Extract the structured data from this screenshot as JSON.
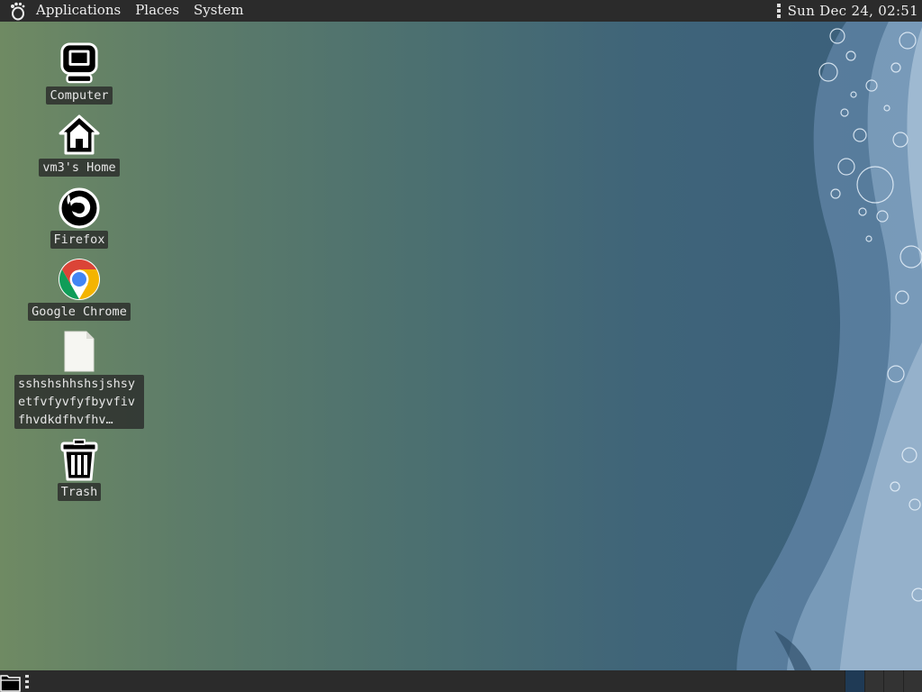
{
  "top_panel": {
    "menus": [
      "Applications",
      "Places",
      "System"
    ],
    "clock": "Sun Dec 24, 02:51"
  },
  "desktop_icons": [
    {
      "label": "Computer",
      "icon": "computer-icon"
    },
    {
      "label": "vm3's Home",
      "icon": "home-folder-icon"
    },
    {
      "label": "Firefox",
      "icon": "firefox-icon"
    },
    {
      "label": "Google Chrome",
      "icon": "chrome-icon"
    },
    {
      "label": "sshshshhshsjshsyetfvfyvfyfbyvfivfhvdkdfhvfhv…",
      "icon": "text-file-icon"
    },
    {
      "label": "Trash",
      "icon": "trash-icon"
    }
  ],
  "bottom_panel": {
    "show_desktop_icon": "show-desktop-icon",
    "workspaces": 4,
    "active_workspace": 1
  },
  "colors": {
    "panel": "#2b2b2b",
    "desktop_left": "#6f8a63",
    "desktop_right": "#3a5f7c",
    "chrome_red": "#db4437",
    "chrome_green": "#0f9d58",
    "chrome_yellow": "#f4b400",
    "chrome_blue": "#4285f4"
  }
}
